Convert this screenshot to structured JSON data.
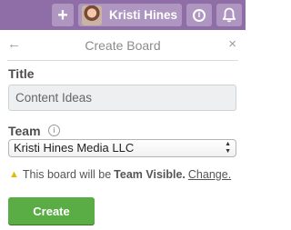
{
  "header": {
    "user_name": "Kristi Hines",
    "add_icon": "+",
    "info_icon": "i"
  },
  "panel": {
    "back_icon": "←",
    "title": "Create Board",
    "close_icon": "×",
    "title_label": "Title",
    "title_value": "Content Ideas",
    "team_label": "Team",
    "team_info_icon": "i",
    "team_selected": "Kristi Hines Media LLC",
    "visibility_prefix": "This board will be",
    "visibility_value": "Team Visible.",
    "change_link": "Change.",
    "create_button": "Create"
  },
  "colors": {
    "header_bg": "#8f6ea8",
    "create_button_bg": "#5aac44",
    "warning_icon": "#e6b800"
  },
  "icons": [
    "plus-icon",
    "avatar",
    "info-icon",
    "bell-icon",
    "back-arrow-icon",
    "close-icon",
    "warning-icon"
  ]
}
